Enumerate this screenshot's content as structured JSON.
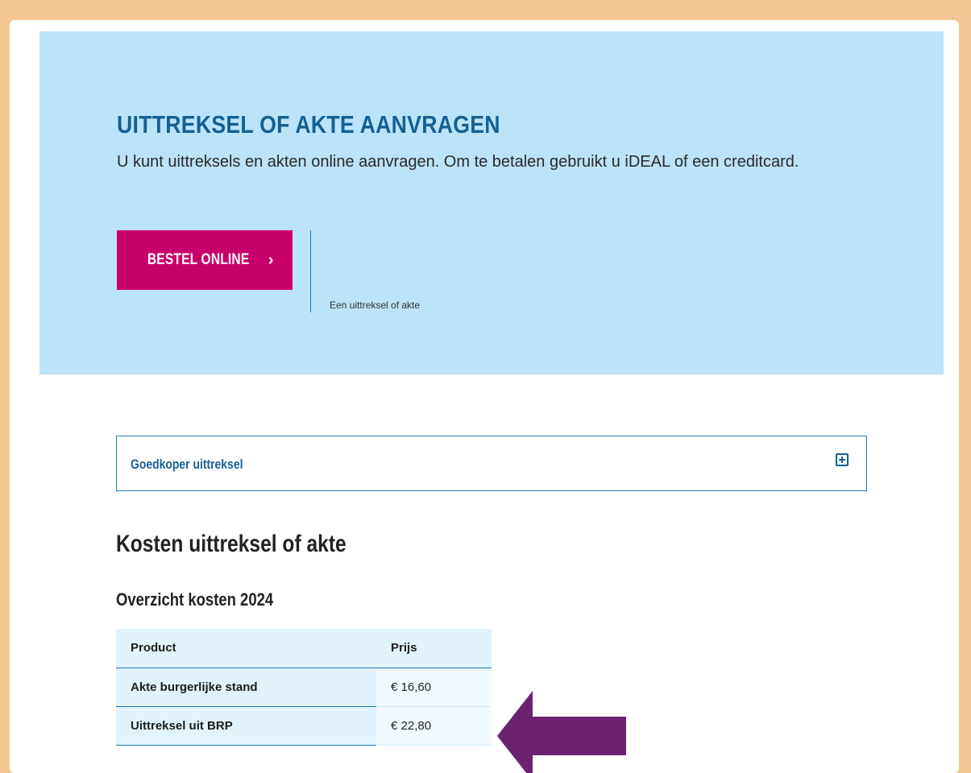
{
  "hero": {
    "title": "UITTREKSEL OF AKTE AANVRAGEN",
    "text": "U kunt uittreksels en akten online aanvragen. Om te betalen gebruikt u iDEAL of een creditcard.",
    "button_label": "BESTEL ONLINE",
    "button_icon": "chevron-right-icon",
    "note": "Een uittreksel of akte"
  },
  "accordion": {
    "label": "Goedkoper uittreksel",
    "icon": "plus-square-icon"
  },
  "costs": {
    "heading": "Kosten uittreksel of akte",
    "subheading": "Overzicht kosten 2024",
    "table": {
      "headers": [
        "Product",
        "Prijs"
      ],
      "rows": [
        [
          "Akte burgerlijke stand",
          "€ 16,60"
        ],
        [
          "Uittreksel uit BRP",
          "€ 22,80"
        ]
      ]
    }
  },
  "colors": {
    "frame": "#f5c893",
    "hero_bg": "#bbe3f9",
    "title": "#155f93",
    "button": "#c8006c",
    "arrow": "#6b2370"
  }
}
